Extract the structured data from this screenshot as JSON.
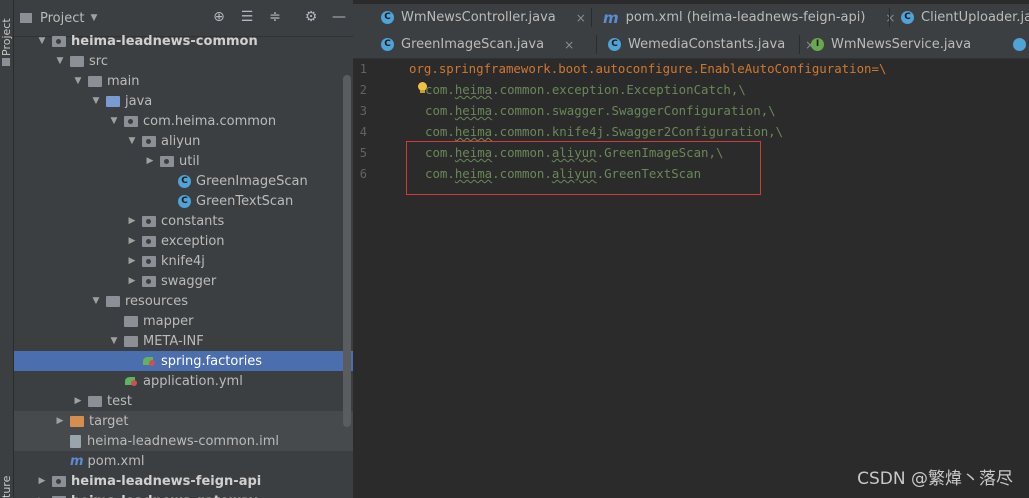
{
  "side_strip": {
    "project_label": "Project",
    "structure_label": "ture"
  },
  "project_panel": {
    "title": "Project",
    "icons": [
      "crosshair-icon",
      "expand-all-icon",
      "collapse-all-icon",
      "gear-icon",
      "minimize-icon"
    ],
    "tree": [
      {
        "label": "heima-leadnews-common",
        "icon": "module",
        "arrow": "down",
        "bold": true
      },
      {
        "label": "src",
        "icon": "folder-gray",
        "arrow": "down"
      },
      {
        "label": "main",
        "icon": "folder-gray",
        "arrow": "down"
      },
      {
        "label": "java",
        "icon": "folder-blue",
        "arrow": "down"
      },
      {
        "label": "com.heima.common",
        "icon": "package",
        "arrow": "down"
      },
      {
        "label": "aliyun",
        "icon": "package",
        "arrow": "down"
      },
      {
        "label": "util",
        "icon": "package",
        "arrow": "right"
      },
      {
        "label": "GreenImageScan",
        "icon": "class",
        "arrow": "none"
      },
      {
        "label": "GreenTextScan",
        "icon": "class",
        "arrow": "none"
      },
      {
        "label": "constants",
        "icon": "package",
        "arrow": "right"
      },
      {
        "label": "exception",
        "icon": "package",
        "arrow": "right"
      },
      {
        "label": "knife4j",
        "icon": "package",
        "arrow": "right"
      },
      {
        "label": "swagger",
        "icon": "package",
        "arrow": "right"
      },
      {
        "label": "resources",
        "icon": "folder-gray",
        "arrow": "down"
      },
      {
        "label": "mapper",
        "icon": "folder-gray",
        "arrow": "none"
      },
      {
        "label": "META-INF",
        "icon": "folder-gray",
        "arrow": "down"
      },
      {
        "label": "spring.factories",
        "icon": "spring",
        "arrow": "none",
        "selected": true
      },
      {
        "label": "application.yml",
        "icon": "spring",
        "arrow": "none"
      },
      {
        "label": "test",
        "icon": "folder-gray",
        "arrow": "right"
      },
      {
        "label": "target",
        "icon": "folder-orange",
        "arrow": "right",
        "highlight": true
      },
      {
        "label": "heima-leadnews-common.iml",
        "icon": "file",
        "arrow": "none",
        "highlight": true
      },
      {
        "label": "pom.xml",
        "icon": "maven",
        "arrow": "none"
      },
      {
        "label": "heima-leadnews-feign-api",
        "icon": "module",
        "arrow": "right",
        "bold": true
      },
      {
        "label": "heima-leadnews-gateway",
        "icon": "module",
        "arrow": "right",
        "bold": true
      }
    ]
  },
  "editor": {
    "tabs_row1": [
      {
        "label": "WmNewsController.java",
        "icon": "c"
      },
      {
        "label": "pom.xml (heima-leadnews-feign-api)",
        "icon": "m"
      },
      {
        "label": "ClientUploader.java",
        "icon": "c"
      }
    ],
    "tabs_row2": [
      {
        "label": "GreenImageScan.java",
        "icon": "c"
      },
      {
        "label": "WemediaConstants.java",
        "icon": "c"
      },
      {
        "label": "WmNewsService.java",
        "icon": "i"
      }
    ],
    "close_symbol": "×",
    "line_numbers": [
      "1",
      "2",
      "3",
      "4",
      "5",
      "6"
    ],
    "lines": {
      "l1": {
        "key": "org.springframework.boot.autoconfigure.EnableAutoConfiguration",
        "eq": "=\\"
      },
      "l2": {
        "a": "com.",
        "u": "heima",
        "b": ".common.exception.ExceptionCatch,\\"
      },
      "l3": {
        "a": "com.",
        "u": "heima",
        "b": ".common.swagger.SwaggerConfiguration,\\"
      },
      "l4": {
        "a": "com.",
        "u": "heima",
        "b": ".common.knife4j.Swagger2Configuration,\\"
      },
      "l5": {
        "a": "com.",
        "u": "heima",
        "b": ".common.",
        "u2": "aliyun",
        "c": ".GreenImageScan,\\"
      },
      "l6": {
        "a": "com.",
        "u": "heima",
        "b": ".common.",
        "u2": "aliyun",
        "c": ".GreenTextScan"
      }
    }
  },
  "watermark": "CSDN @繁煒丶落尽",
  "colors": {
    "selected_row": "#4b6eaf",
    "property_key": "#cc7832",
    "property_value": "#6a8759",
    "highlight_box": "#d23a3a"
  }
}
